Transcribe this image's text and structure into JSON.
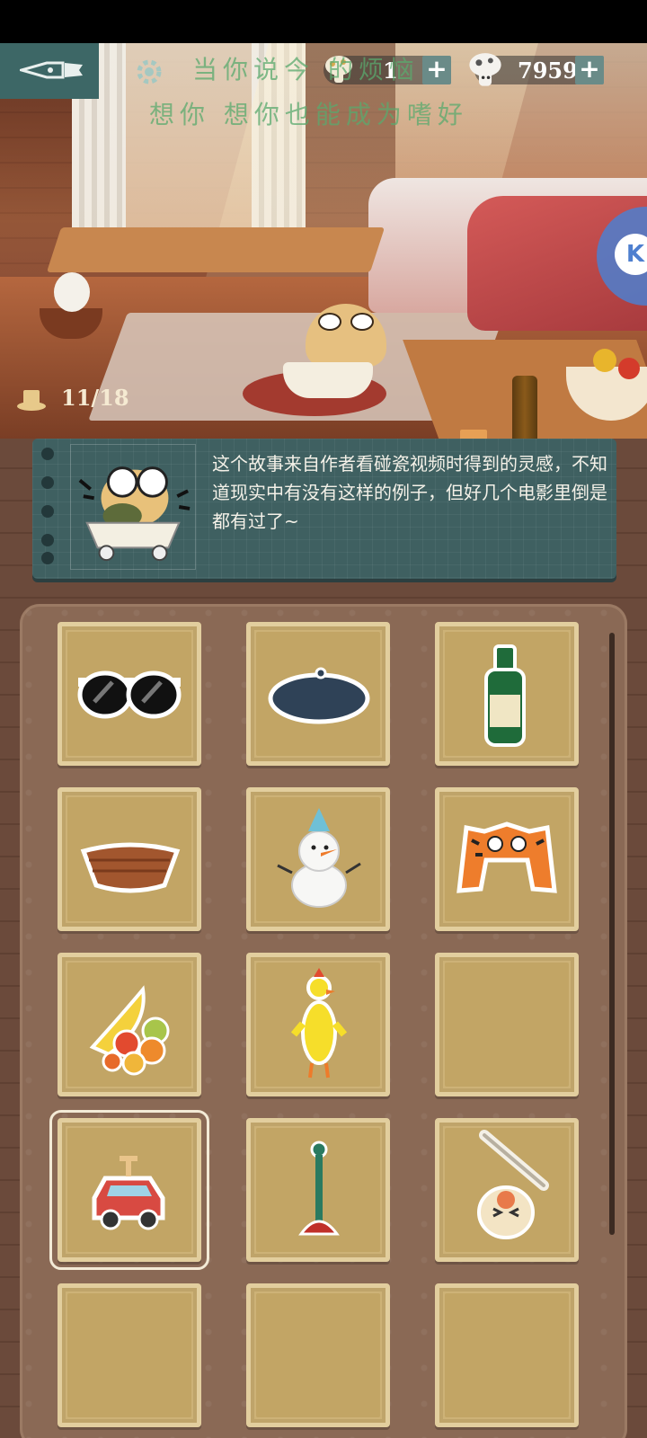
{
  "hud": {
    "currency_1": "1",
    "currency_2": "7959",
    "overlay_line_1": "当你说今    的烦恼",
    "overlay_line_2": "想你 想你也能成为嗜好"
  },
  "progress": {
    "text": "11/18",
    "collected": 11,
    "total": 18
  },
  "story": {
    "text": "这个故事来自作者看碰瓷视频时得到的灵感，不知道现实中有没有这样的例子，但好几个电影里倒是都有过了~"
  },
  "inventory": {
    "items": [
      {
        "name": "sunglasses",
        "icon": "sunglasses-icon"
      },
      {
        "name": "beret",
        "icon": "beret-icon"
      },
      {
        "name": "green bottle",
        "icon": "bottle-icon"
      },
      {
        "name": "wicker basket",
        "icon": "basket-icon"
      },
      {
        "name": "snowman",
        "icon": "snowman-icon"
      },
      {
        "name": "tiger hat",
        "icon": "tiger-hat-icon"
      },
      {
        "name": "fruit pile",
        "icon": "fruit-icon"
      },
      {
        "name": "rubber chicken",
        "icon": "rubber-chicken-icon"
      },
      {
        "name": "empty",
        "icon": ""
      },
      {
        "name": "wind-up car",
        "icon": "toy-car-icon"
      },
      {
        "name": "plunger",
        "icon": "plunger-icon"
      },
      {
        "name": "cat with stick",
        "icon": "cat-stick-icon"
      },
      {
        "name": "empty",
        "icon": ""
      },
      {
        "name": "empty",
        "icon": ""
      },
      {
        "name": "empty",
        "icon": ""
      }
    ],
    "selected_index": 9
  },
  "colors": {
    "hud_teal": "#3d6766",
    "story_card": "#3f6061",
    "panel_brown": "#8a6955",
    "slot_gold": "#cdb277"
  }
}
